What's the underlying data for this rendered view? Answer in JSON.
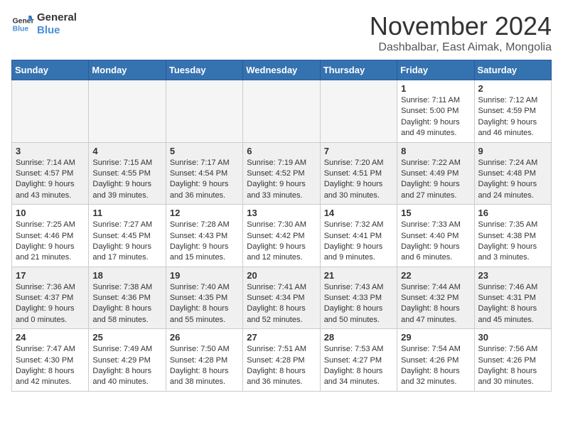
{
  "logo": {
    "line1": "General",
    "line2": "Blue"
  },
  "title": "November 2024",
  "location": "Dashbalbar, East Aimak, Mongolia",
  "weekdays": [
    "Sunday",
    "Monday",
    "Tuesday",
    "Wednesday",
    "Thursday",
    "Friday",
    "Saturday"
  ],
  "weeks": [
    [
      {
        "day": "",
        "info": ""
      },
      {
        "day": "",
        "info": ""
      },
      {
        "day": "",
        "info": ""
      },
      {
        "day": "",
        "info": ""
      },
      {
        "day": "",
        "info": ""
      },
      {
        "day": "1",
        "info": "Sunrise: 7:11 AM\nSunset: 5:00 PM\nDaylight: 9 hours\nand 49 minutes."
      },
      {
        "day": "2",
        "info": "Sunrise: 7:12 AM\nSunset: 4:59 PM\nDaylight: 9 hours\nand 46 minutes."
      }
    ],
    [
      {
        "day": "3",
        "info": "Sunrise: 7:14 AM\nSunset: 4:57 PM\nDaylight: 9 hours\nand 43 minutes."
      },
      {
        "day": "4",
        "info": "Sunrise: 7:15 AM\nSunset: 4:55 PM\nDaylight: 9 hours\nand 39 minutes."
      },
      {
        "day": "5",
        "info": "Sunrise: 7:17 AM\nSunset: 4:54 PM\nDaylight: 9 hours\nand 36 minutes."
      },
      {
        "day": "6",
        "info": "Sunrise: 7:19 AM\nSunset: 4:52 PM\nDaylight: 9 hours\nand 33 minutes."
      },
      {
        "day": "7",
        "info": "Sunrise: 7:20 AM\nSunset: 4:51 PM\nDaylight: 9 hours\nand 30 minutes."
      },
      {
        "day": "8",
        "info": "Sunrise: 7:22 AM\nSunset: 4:49 PM\nDaylight: 9 hours\nand 27 minutes."
      },
      {
        "day": "9",
        "info": "Sunrise: 7:24 AM\nSunset: 4:48 PM\nDaylight: 9 hours\nand 24 minutes."
      }
    ],
    [
      {
        "day": "10",
        "info": "Sunrise: 7:25 AM\nSunset: 4:46 PM\nDaylight: 9 hours\nand 21 minutes."
      },
      {
        "day": "11",
        "info": "Sunrise: 7:27 AM\nSunset: 4:45 PM\nDaylight: 9 hours\nand 17 minutes."
      },
      {
        "day": "12",
        "info": "Sunrise: 7:28 AM\nSunset: 4:43 PM\nDaylight: 9 hours\nand 15 minutes."
      },
      {
        "day": "13",
        "info": "Sunrise: 7:30 AM\nSunset: 4:42 PM\nDaylight: 9 hours\nand 12 minutes."
      },
      {
        "day": "14",
        "info": "Sunrise: 7:32 AM\nSunset: 4:41 PM\nDaylight: 9 hours\nand 9 minutes."
      },
      {
        "day": "15",
        "info": "Sunrise: 7:33 AM\nSunset: 4:40 PM\nDaylight: 9 hours\nand 6 minutes."
      },
      {
        "day": "16",
        "info": "Sunrise: 7:35 AM\nSunset: 4:38 PM\nDaylight: 9 hours\nand 3 minutes."
      }
    ],
    [
      {
        "day": "17",
        "info": "Sunrise: 7:36 AM\nSunset: 4:37 PM\nDaylight: 9 hours\nand 0 minutes."
      },
      {
        "day": "18",
        "info": "Sunrise: 7:38 AM\nSunset: 4:36 PM\nDaylight: 8 hours\nand 58 minutes."
      },
      {
        "day": "19",
        "info": "Sunrise: 7:40 AM\nSunset: 4:35 PM\nDaylight: 8 hours\nand 55 minutes."
      },
      {
        "day": "20",
        "info": "Sunrise: 7:41 AM\nSunset: 4:34 PM\nDaylight: 8 hours\nand 52 minutes."
      },
      {
        "day": "21",
        "info": "Sunrise: 7:43 AM\nSunset: 4:33 PM\nDaylight: 8 hours\nand 50 minutes."
      },
      {
        "day": "22",
        "info": "Sunrise: 7:44 AM\nSunset: 4:32 PM\nDaylight: 8 hours\nand 47 minutes."
      },
      {
        "day": "23",
        "info": "Sunrise: 7:46 AM\nSunset: 4:31 PM\nDaylight: 8 hours\nand 45 minutes."
      }
    ],
    [
      {
        "day": "24",
        "info": "Sunrise: 7:47 AM\nSunset: 4:30 PM\nDaylight: 8 hours\nand 42 minutes."
      },
      {
        "day": "25",
        "info": "Sunrise: 7:49 AM\nSunset: 4:29 PM\nDaylight: 8 hours\nand 40 minutes."
      },
      {
        "day": "26",
        "info": "Sunrise: 7:50 AM\nSunset: 4:28 PM\nDaylight: 8 hours\nand 38 minutes."
      },
      {
        "day": "27",
        "info": "Sunrise: 7:51 AM\nSunset: 4:28 PM\nDaylight: 8 hours\nand 36 minutes."
      },
      {
        "day": "28",
        "info": "Sunrise: 7:53 AM\nSunset: 4:27 PM\nDaylight: 8 hours\nand 34 minutes."
      },
      {
        "day": "29",
        "info": "Sunrise: 7:54 AM\nSunset: 4:26 PM\nDaylight: 8 hours\nand 32 minutes."
      },
      {
        "day": "30",
        "info": "Sunrise: 7:56 AM\nSunset: 4:26 PM\nDaylight: 8 hours\nand 30 minutes."
      }
    ]
  ]
}
